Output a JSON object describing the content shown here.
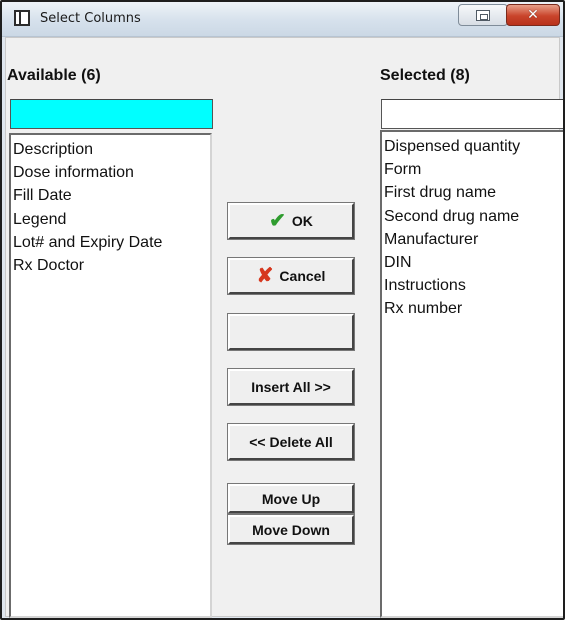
{
  "window": {
    "title": "Select Columns",
    "close_glyph": "✕"
  },
  "available": {
    "header": "Available (6)",
    "filter_value": "",
    "items": [
      "Description",
      "Dose information",
      "Fill Date",
      "Legend",
      "Lot# and Expiry Date",
      "Rx Doctor"
    ]
  },
  "selected": {
    "header": "Selected (8)",
    "filter_value": "",
    "items": [
      "Dispensed quantity",
      "Form",
      "First drug name",
      "Second drug name",
      "Manufacturer",
      "DIN",
      "Instructions",
      "Rx number"
    ]
  },
  "buttons": {
    "ok": "OK",
    "cancel": "Cancel",
    "blank": "",
    "insert_all": "Insert All >>",
    "delete_all": "<< Delete All",
    "move_up": "Move Up",
    "move_down": "Move Down"
  },
  "icons": {
    "ok": "check-icon",
    "cancel": "x-icon",
    "title": "window-icon"
  },
  "colors": {
    "filter_highlight": "#00ffff",
    "ok_check": "#2f9c2f",
    "cancel_x": "#d6371e"
  }
}
